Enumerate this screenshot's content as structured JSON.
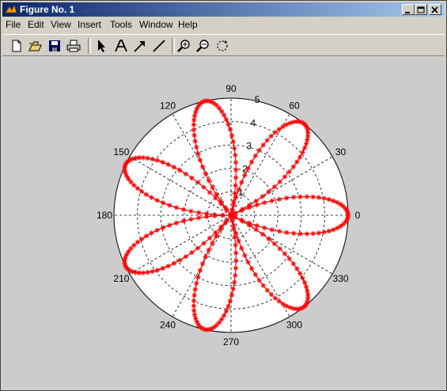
{
  "window": {
    "title": "Figure No. 1",
    "controls": {
      "minimize": "minimize",
      "maximize": "maximize",
      "close": "close"
    }
  },
  "menubar": {
    "items": [
      "File",
      "Edit",
      "View",
      "Insert",
      "Tools",
      "Window",
      "Help"
    ]
  },
  "toolbar": {
    "tools": [
      "new-figure-icon",
      "open-file-icon",
      "save-icon",
      "print-icon",
      "select-arrow-icon",
      "insert-text-icon",
      "insert-arrow-icon",
      "insert-line-icon",
      "zoom-in-icon",
      "zoom-out-icon",
      "rotate-3d-icon"
    ]
  },
  "colors": {
    "title_start": "#0a246a",
    "title_end": "#a6caf0",
    "plot_line": "#ff0000",
    "figure_bg": "#cccccc",
    "window_bg": "#d4d0c8"
  },
  "chart_data": {
    "type": "polar",
    "rmax": 5,
    "radial_ticks": [
      "1",
      "2",
      "3",
      "4",
      "5"
    ],
    "angle_ticks": [
      "0",
      "30",
      "60",
      "90",
      "120",
      "150",
      "180",
      "210",
      "240",
      "270",
      "300",
      "330"
    ],
    "series": [
      {
        "marker": "*",
        "color": "#ff0000",
        "line": "solid",
        "equation": "r = 5*|cos(3.5*theta)|",
        "samples": 314
      }
    ],
    "grid": true
  }
}
